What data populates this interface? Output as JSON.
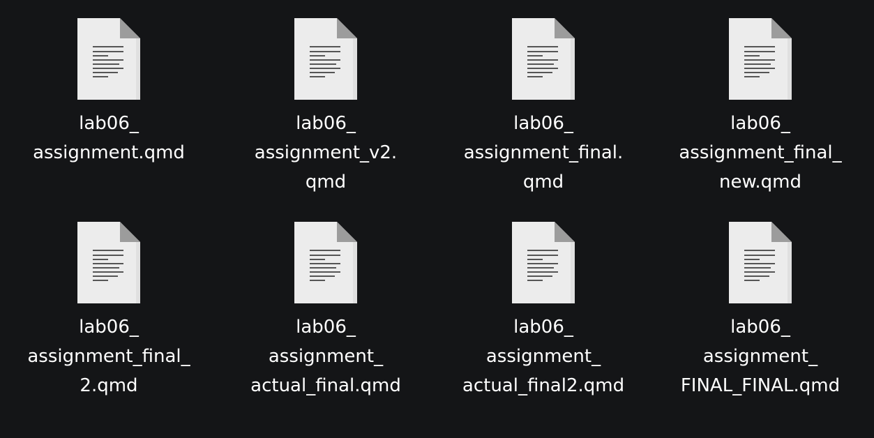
{
  "files": [
    {
      "name": "lab06_assignment.qmd",
      "lines": [
        "lab06_",
        "assignment.qmd"
      ],
      "icon": "document-icon"
    },
    {
      "name": "lab06_assignment_v2.qmd",
      "lines": [
        "lab06_",
        "assignment_v2.",
        "qmd"
      ],
      "icon": "document-icon"
    },
    {
      "name": "lab06_assignment_final.qmd",
      "lines": [
        "lab06_",
        "assignment_final.",
        "qmd"
      ],
      "icon": "document-icon"
    },
    {
      "name": "lab06_assignment_final_new.qmd",
      "lines": [
        "lab06_",
        "assignment_final_",
        "new.qmd"
      ],
      "icon": "document-icon"
    },
    {
      "name": "lab06_assignment_final_2.qmd",
      "lines": [
        "lab06_",
        "assignment_final_",
        "2.qmd"
      ],
      "icon": "document-icon"
    },
    {
      "name": "lab06_assignment_actual_final.qmd",
      "lines": [
        "lab06_",
        "assignment_",
        "actual_final.qmd"
      ],
      "icon": "document-icon"
    },
    {
      "name": "lab06_assignment_actual_final2.qmd",
      "lines": [
        "lab06_",
        "assignment_",
        "actual_final2.qmd"
      ],
      "icon": "document-icon"
    },
    {
      "name": "lab06_assignment_FINAL_FINAL.qmd",
      "lines": [
        "lab06_",
        "assignment_",
        "FINAL_FINAL.qmd"
      ],
      "icon": "document-icon"
    }
  ],
  "colors": {
    "background": "#141517",
    "text": "#ffffff",
    "page": "#ececec",
    "fold": "#9c9c9c",
    "text_lines": "#555555"
  }
}
